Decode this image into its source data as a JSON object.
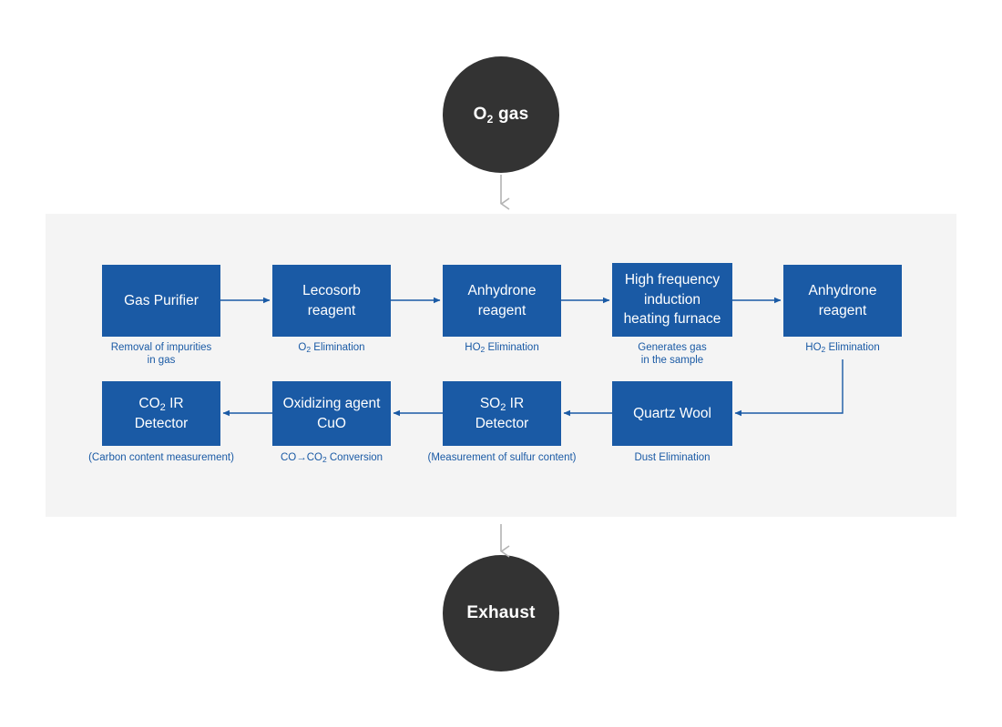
{
  "diagram": {
    "title": "Elemental analyzer gas flow diagram",
    "colors": {
      "box_fill": "#1a5aa5",
      "circle_fill": "#333333",
      "panel_bg": "#f4f4f4",
      "connector_blue": "#1a5aa5",
      "connector_gray": "#b3b3b3",
      "page_bg": "#ffffff"
    }
  },
  "inlet": {
    "label_html": "O<sub>2</sub> gas",
    "label_text": "O2 gas"
  },
  "outlet": {
    "label_html": "Exhaust",
    "label_text": "Exhaust"
  },
  "arrows": {
    "inlet_arrow_icon": "arrow-down-icon",
    "outlet_arrow_icon": "arrow-down-icon"
  },
  "row1": [
    {
      "id": "gas-purifier",
      "label_html": "Gas Purifier",
      "label_text": "Gas Purifier",
      "caption_html": "Removal of impurities<br>in gas",
      "caption_text": "Removal of impurities in gas"
    },
    {
      "id": "lecosorb-reagent",
      "label_html": "Lecosorb<br>reagent",
      "label_text": "Lecosorb reagent",
      "caption_html": "O<sub>2</sub> Elimination",
      "caption_text": "O2 Elimination"
    },
    {
      "id": "anhydrone-reagent-1",
      "label_html": "Anhydrone<br>reagent",
      "label_text": "Anhydrone reagent",
      "caption_html": "HO<sub>2</sub> Elimination",
      "caption_text": "HO2 Elimination"
    },
    {
      "id": "high-frequency-induction-heating-furnace",
      "label_html": "High frequency<br>induction<br>heating furnace",
      "label_text": "High frequency induction heating furnace",
      "caption_html": "Generates gas<br>in the sample",
      "caption_text": "Generates gas in the sample"
    },
    {
      "id": "anhydrone-reagent-2",
      "label_html": "Anhydrone<br>reagent",
      "label_text": "Anhydrone reagent",
      "caption_html": "HO<sub>2</sub> Elimination",
      "caption_text": "HO2 Elimination"
    }
  ],
  "row2": [
    {
      "id": "co2-ir-detector",
      "label_html": "CO<sub>2</sub> IR<br>Detector",
      "label_text": "CO2 IR Detector",
      "caption_html": "(Carbon content measurement)",
      "caption_text": "(Carbon content measurement)"
    },
    {
      "id": "oxidizing-agent-cuo",
      "label_html": "Oxidizing agent<br>CuO",
      "label_text": "Oxidizing agent CuO",
      "caption_html": "CO&#8594;CO<sub>2</sub> Conversion",
      "caption_text": "CO→CO2 Conversion"
    },
    {
      "id": "so2-ir-detector",
      "label_html": "SO<sub>2</sub> IR<br>Detector",
      "label_text": "SO2 IR Detector",
      "caption_html": "(Measurement of sulfur content)",
      "caption_text": "(Measurement of sulfur content)"
    },
    {
      "id": "quartz-wool",
      "label_html": "Quartz Wool",
      "label_text": "Quartz Wool",
      "caption_html": "Dust Elimination",
      "caption_text": "Dust Elimination"
    }
  ],
  "chart_data": {
    "type": "diagram",
    "flow_order": [
      "O2 gas",
      "Gas Purifier",
      "Lecosorb reagent",
      "Anhydrone reagent",
      "High frequency induction heating furnace",
      "Anhydrone reagent",
      "Quartz Wool",
      "SO2 IR Detector",
      "Oxidizing agent CuO",
      "CO2 IR Detector",
      "Exhaust"
    ]
  }
}
